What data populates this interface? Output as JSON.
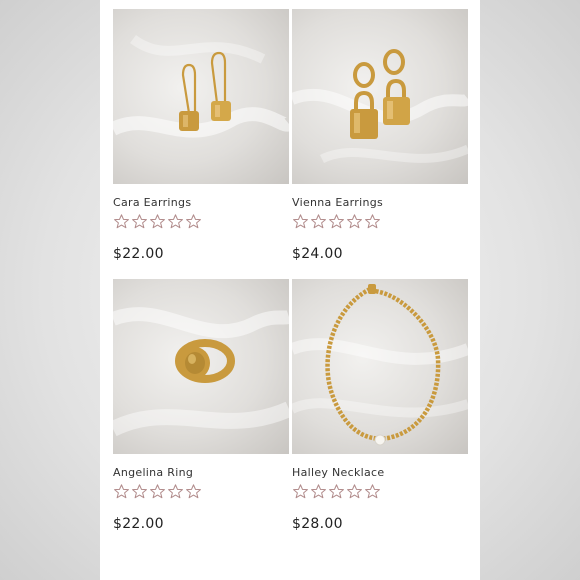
{
  "products": [
    {
      "name": "Cara Earrings",
      "price": "$22.00",
      "rating": 0,
      "max_rating": 5
    },
    {
      "name": "Vienna Earrings",
      "price": "$24.00",
      "rating": 0,
      "max_rating": 5
    },
    {
      "name": "Angelina Ring",
      "price": "$22.00",
      "rating": 0,
      "max_rating": 5
    },
    {
      "name": "Halley Necklace",
      "price": "$28.00",
      "rating": 0,
      "max_rating": 5
    }
  ],
  "colors": {
    "star_outline": "#b08a8a",
    "gold": "#c99a3e",
    "background": "#ffffff"
  },
  "icons": {
    "rating": "star-outline-icon"
  }
}
